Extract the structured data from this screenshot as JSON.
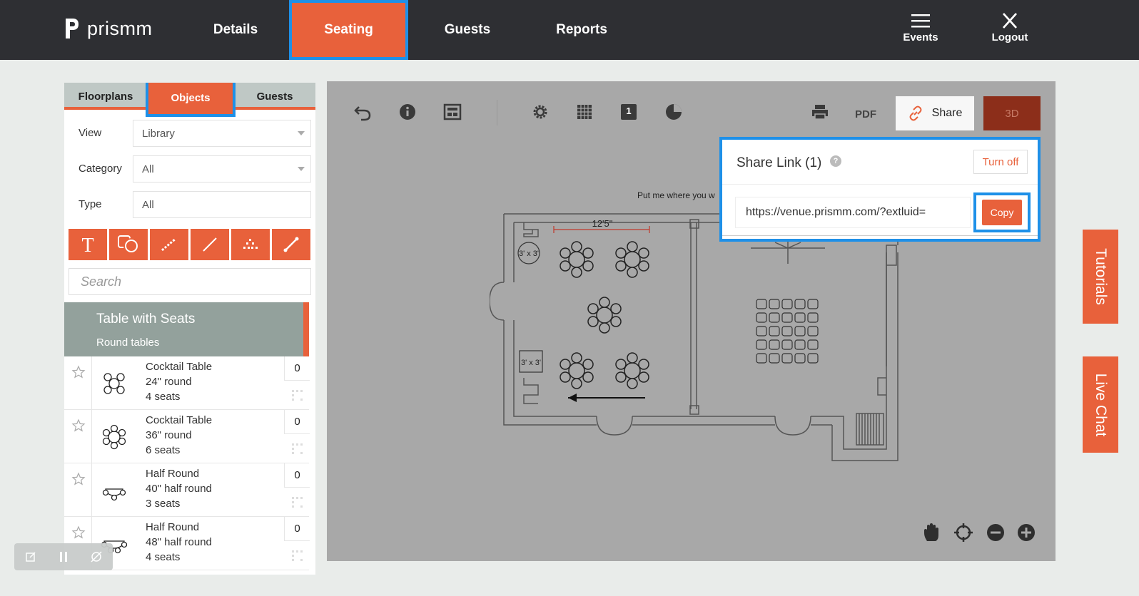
{
  "brand": {
    "name": "prismm"
  },
  "nav": {
    "items": [
      {
        "label": "Details"
      },
      {
        "label": "Seating"
      },
      {
        "label": "Guests"
      },
      {
        "label": "Reports"
      }
    ],
    "events_label": "Events",
    "logout_label": "Logout"
  },
  "sidebar": {
    "tabs": [
      {
        "label": "Floorplans"
      },
      {
        "label": "Objects"
      },
      {
        "label": "Guests"
      }
    ],
    "view": {
      "label": "View",
      "value": "Library"
    },
    "category": {
      "label": "Category",
      "value": "All"
    },
    "type": {
      "label": "Type",
      "value": "All"
    },
    "tools": [
      "text-tool-icon",
      "shape-tool-icon",
      "measure-tool-icon",
      "line-tool-icon",
      "seating-area-icon",
      "edit-line-icon"
    ],
    "search_placeholder": "Search",
    "category_header": {
      "title": "Table with Seats",
      "subtitle": "Round tables"
    },
    "objects": [
      {
        "name": "Cocktail Table",
        "size": "24\" round",
        "seats": "4 seats",
        "count": "0"
      },
      {
        "name": "Cocktail Table",
        "size": "36\" round",
        "seats": "6 seats",
        "count": "0"
      },
      {
        "name": "Half Round",
        "size": "40\" half round",
        "seats": "3 seats",
        "count": "0"
      },
      {
        "name": "Half Round",
        "size": "48\" half round",
        "seats": "4 seats",
        "count": "0"
      }
    ]
  },
  "canvas": {
    "toolbar": {
      "pdf_label": "PDF",
      "share_label": "Share",
      "threed_label": "3D",
      "page_badge": "1"
    },
    "floorplan": {
      "dimension_label": "12'5\"",
      "box_label_1": "3' x 3'",
      "box_label_2": "3' x 3'",
      "put_text": "Put me where you w"
    }
  },
  "share_popup": {
    "title": "Share Link (1)",
    "help": "?",
    "turn_off_label": "Turn off",
    "url": "https://venue.prismm.com/?extluid=",
    "copy_label": "Copy"
  },
  "side_tabs": {
    "tutorials": "Tutorials",
    "live_chat": "Live Chat"
  },
  "colors": {
    "accent": "#e8613b",
    "topbar": "#2e2f33",
    "highlight": "#1e90e8"
  }
}
